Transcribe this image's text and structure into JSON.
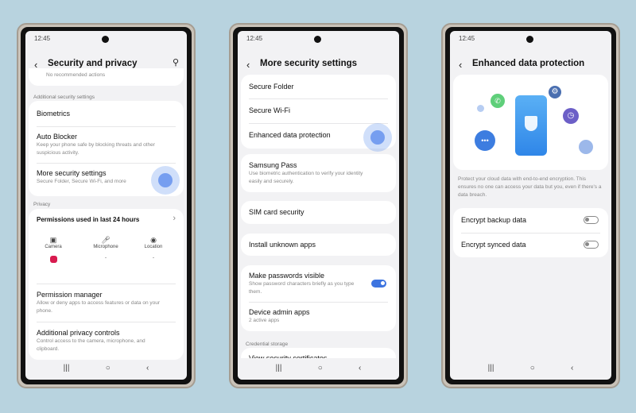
{
  "status_time": "12:45",
  "screen1": {
    "title": "Security and privacy",
    "top_item": "No recommended actions",
    "section_additional": "Additional security settings",
    "items": [
      {
        "title": "Biometrics"
      },
      {
        "title": "Auto Blocker",
        "subtitle": "Keep your phone safe by blocking threats and other suspicious activity."
      },
      {
        "title": "More security settings",
        "subtitle": "Secure Folder, Secure Wi-Fi, and more"
      }
    ],
    "section_privacy": "Privacy",
    "permissions_title": "Permissions used in last 24 hours",
    "permissions": [
      {
        "label": "Camera",
        "icon": "camera-icon",
        "value": ""
      },
      {
        "label": "Microphone",
        "icon": "microphone-icon",
        "value": "-"
      },
      {
        "label": "Location",
        "icon": "location-icon",
        "value": "-"
      }
    ],
    "privacy_items": [
      {
        "title": "Permission manager",
        "subtitle": "Allow or deny apps to access features or data on your phone."
      },
      {
        "title": "Additional privacy controls",
        "subtitle": "Control access to the camera, microphone, and clipboard."
      }
    ]
  },
  "screen2": {
    "title": "More security settings",
    "items": [
      {
        "title": "Secure Folder"
      },
      {
        "title": "Secure Wi-Fi"
      },
      {
        "title": "Enhanced data protection"
      }
    ],
    "samsung_pass": {
      "title": "Samsung Pass",
      "subtitle": "Use biometric authentication to verify your identity easily and securely."
    },
    "sim": "SIM card security",
    "install": "Install unknown apps",
    "passwords": {
      "title": "Make passwords visible",
      "subtitle": "Show password characters briefly as you type them.",
      "enabled": true
    },
    "device_admin": {
      "title": "Device admin apps",
      "subtitle": "2 active apps"
    },
    "section_credential": "Credential storage",
    "partial_item": "View security certificates"
  },
  "screen3": {
    "title": "Enhanced data protection",
    "description": "Protect your cloud data with end-to-end encryption. This ensures no one can access your data but you, even if there's a data breach.",
    "toggles": [
      {
        "label": "Encrypt backup data",
        "enabled": false
      },
      {
        "label": "Encrypt synced data",
        "enabled": false
      }
    ]
  },
  "nav": {
    "recents": "|||",
    "home": "○",
    "back": "‹"
  },
  "colors": {
    "accent": "#3d74e0",
    "background": "#b8d3df",
    "camera_badge": "#d81b4f"
  }
}
